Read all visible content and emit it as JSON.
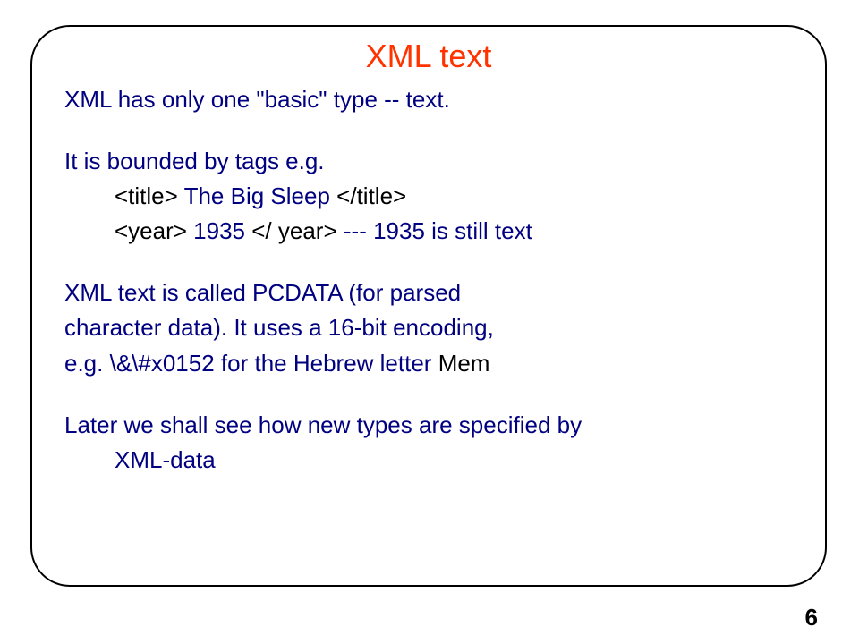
{
  "slide": {
    "title": "XML text",
    "p1": "XML has only one \"basic\" type -- text.",
    "p2": "It is bounded by tags e.g.",
    "ex1_open": "<title> ",
    "ex1_mid": "The Big Sleep ",
    "ex1_close": "</title>",
    "ex2_open": "<year> ",
    "ex2_mid": "1935 ",
    "ex2_close": "</ year>",
    "ex2_tail": "    --- 1935 is still text",
    "p3a": "XML text is called PCDATA (for parsed",
    "p3b": "character data).  It uses a 16-bit encoding,",
    "p3c_prefix": "e.g. ",
    "p3c_code": "\\&\\#x0152 for the Hebrew letter ",
    "p3c_tail": "Mem",
    "p4a": "Later we shall see how new types are specified by",
    "p4b": "XML-data",
    "page_number": "6"
  }
}
